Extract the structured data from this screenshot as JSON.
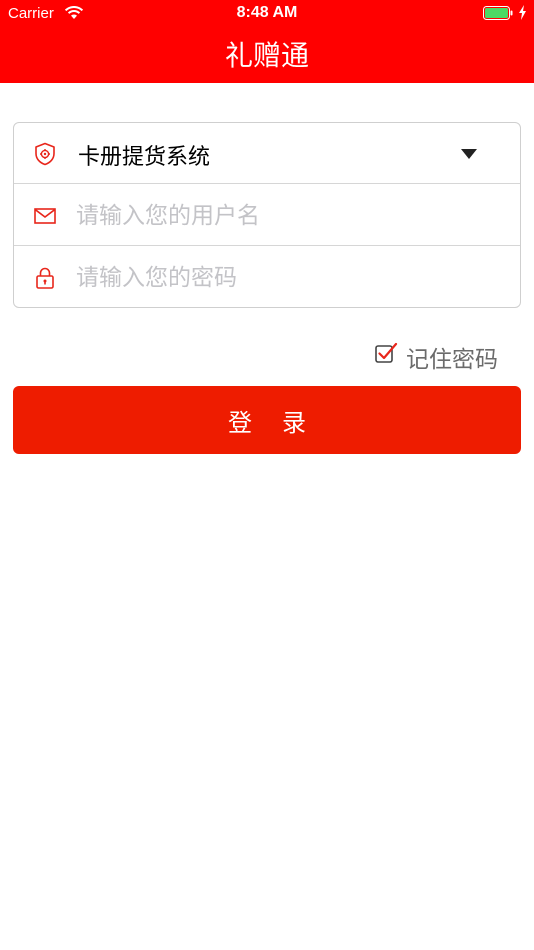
{
  "status_bar": {
    "carrier": "Carrier",
    "time": "8:48 AM"
  },
  "header": {
    "title": "礼赠通",
    "background_color": "#ff0000"
  },
  "form": {
    "system_select": {
      "value": "卡册提货系统",
      "icon": "shield-icon"
    },
    "username": {
      "placeholder": "请输入您的用户名",
      "value": "",
      "icon": "mail-icon"
    },
    "password": {
      "placeholder": "请输入您的密码",
      "value": "",
      "icon": "lock-icon"
    }
  },
  "remember": {
    "label": "记住密码",
    "checked": true
  },
  "login_button": {
    "label": "登录",
    "color": "#ee1c00"
  }
}
